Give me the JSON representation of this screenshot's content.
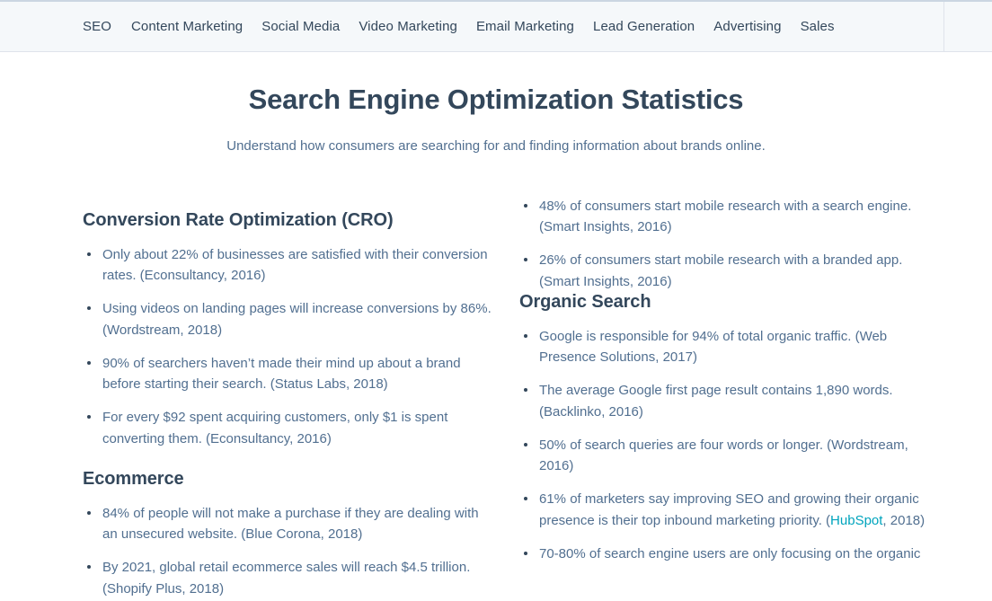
{
  "nav": {
    "items": [
      {
        "label": "SEO"
      },
      {
        "label": "Content Marketing"
      },
      {
        "label": "Social Media"
      },
      {
        "label": "Video Marketing"
      },
      {
        "label": "Email Marketing"
      },
      {
        "label": "Lead Generation"
      },
      {
        "label": "Advertising"
      },
      {
        "label": "Sales"
      }
    ]
  },
  "header": {
    "title": "Search Engine Optimization Statistics",
    "subtitle": "Understand how consumers are searching for and finding information about brands online."
  },
  "colors": {
    "page_background": "#ffffff",
    "nav_background": "#f5f8fa",
    "nav_top_border": "#cbd6e2",
    "heading_text": "#33475b",
    "body_text": "#516f90",
    "link": "#00a4bd"
  },
  "left_column": {
    "sections": [
      {
        "heading": "Conversion Rate Optimization (CRO)",
        "items": [
          "Only about 22% of businesses are satisfied with their conversion rates. (Econsultancy, 2016)",
          "Using videos on landing pages will increase conversions by 86%. (Wordstream, 2018)",
          "90% of searchers haven’t made their mind up about a brand before starting their search. (Status Labs, 2018)",
          "For every $92 spent acquiring customers, only $1 is spent converting them. (Econsultancy, 2016)"
        ]
      },
      {
        "heading": "Ecommerce",
        "items": [
          "84% of people will not make a purchase if they are dealing with an unsecured website. (Blue Corona, 2018)",
          "By 2021, global retail ecommerce sales will reach $4.5 trillion. (Shopify Plus, 2018)"
        ]
      }
    ]
  },
  "right_column": {
    "lead_items": [
      "48% of consumers start mobile research with a search engine. (Smart Insights, 2016)",
      "26% of consumers start mobile research with a branded app. (Smart Insights, 2016)"
    ],
    "sections": [
      {
        "heading": "Organic Search",
        "items": [
          "Google is responsible for 94% of total organic traffic. (Web Presence Solutions, 2017)",
          "The average Google first page result contains 1,890 words. (Backlinko, 2016)",
          "50% of search queries are four words or longer. (Wordstream, 2016)"
        ],
        "link_item": {
          "text_before": "61% of marketers say improving SEO and growing their organic presence is their top inbound marketing priority. (",
          "link_text": "HubSpot",
          "text_after": ", 2018)"
        },
        "truncated_item": "70-80% of search engine users are only focusing on the organic"
      }
    ]
  }
}
